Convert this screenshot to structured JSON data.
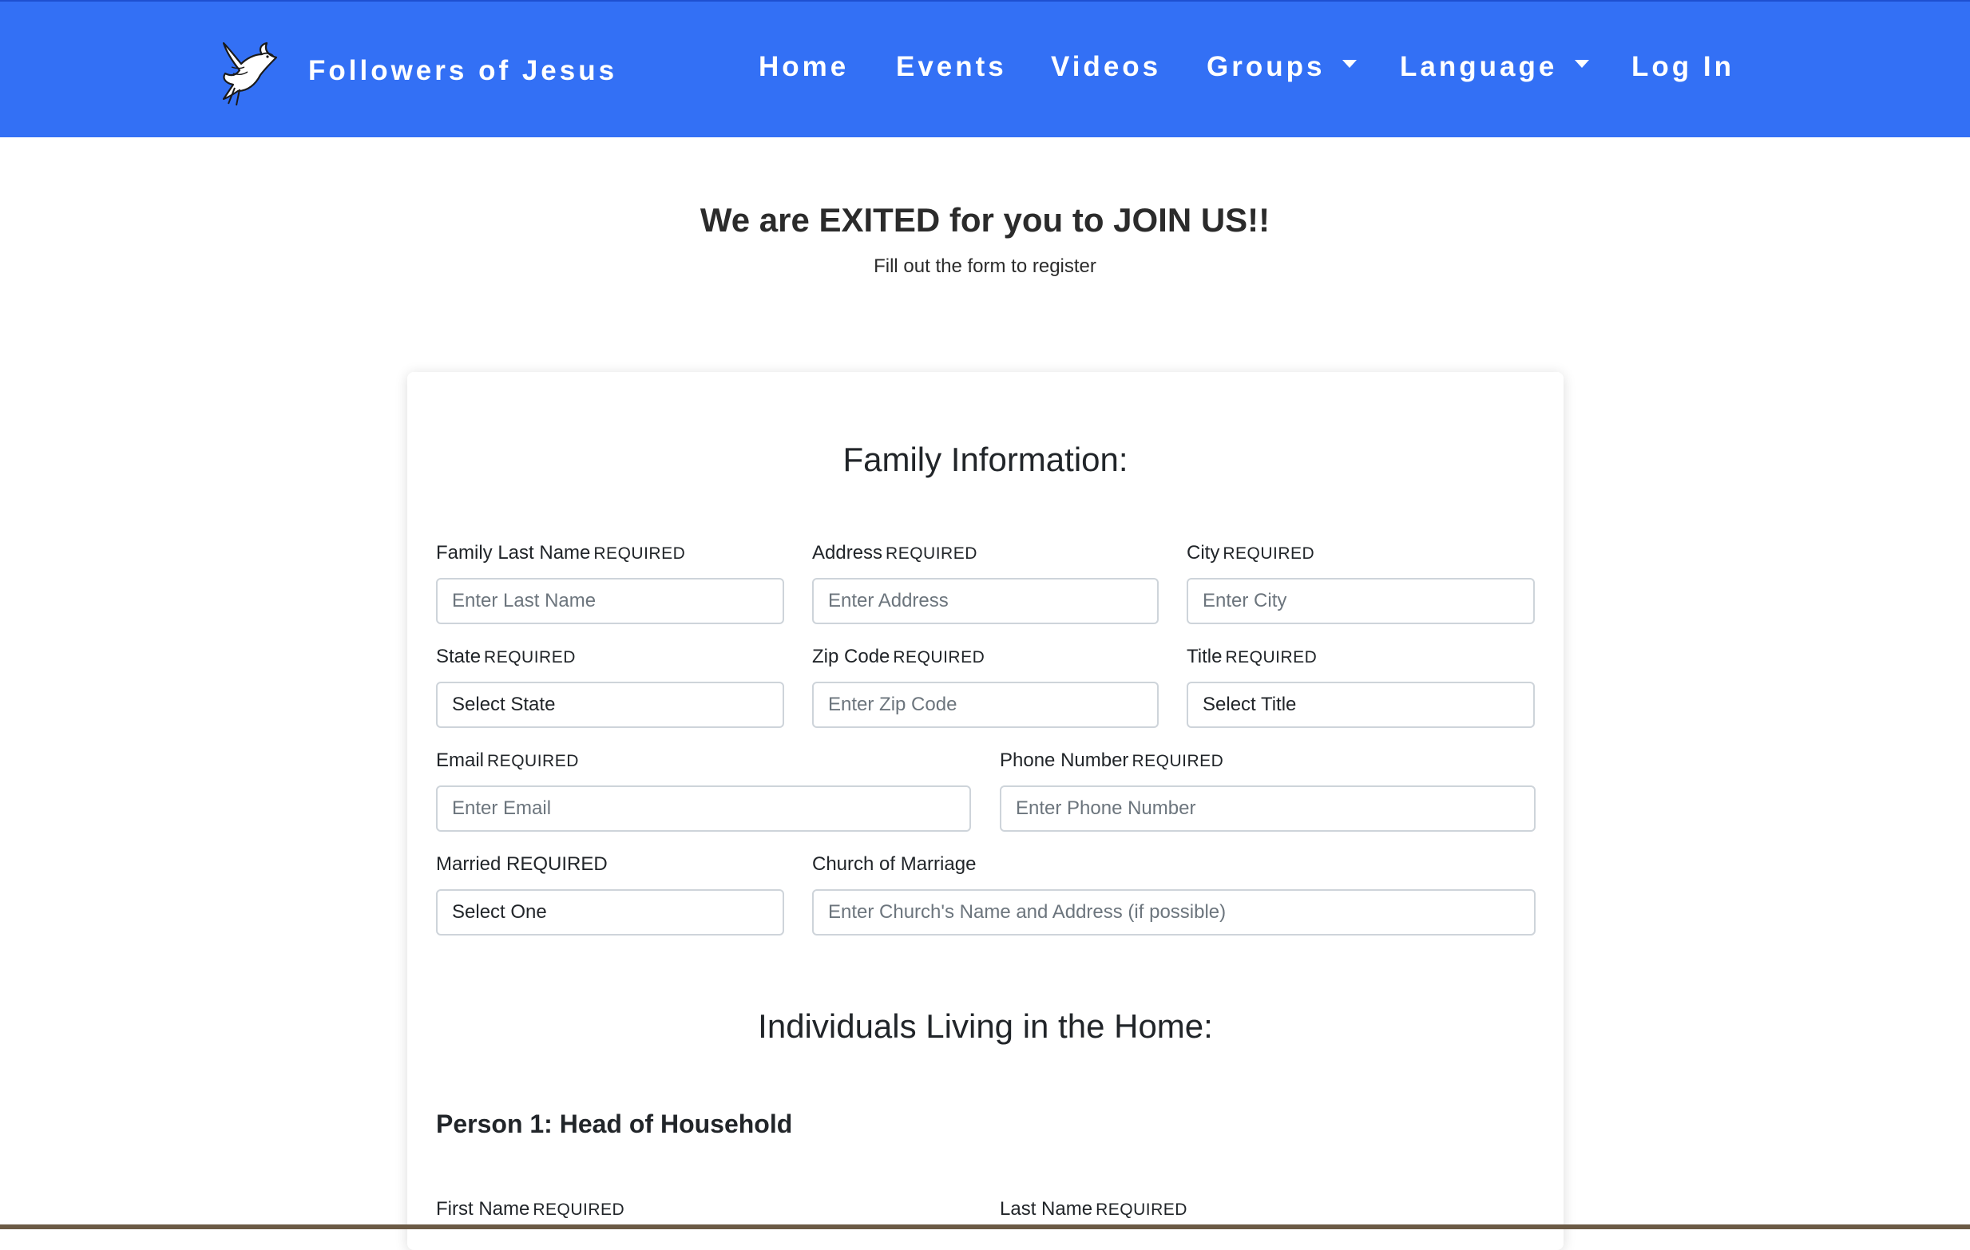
{
  "navbar": {
    "brand_name": "Followers of Jesus",
    "logo_icon": "dove-icon",
    "bg_color": "#3370f5",
    "items": [
      {
        "label": "Home"
      },
      {
        "label": "Events"
      },
      {
        "label": "Videos"
      },
      {
        "label": "Groups"
      },
      {
        "label": "Language"
      },
      {
        "label": "Log In"
      }
    ]
  },
  "hero": {
    "title": "We are EXITED for you to JOIN US!!",
    "subtitle": "Fill out the form to register"
  },
  "form": {
    "family_section_title": "Family Information:",
    "required_text": "REQUIRED",
    "fields": {
      "last_name": {
        "label": "Family Last Name",
        "placeholder": "Enter Last Name"
      },
      "address": {
        "label": "Address",
        "placeholder": "Enter Address"
      },
      "city": {
        "label": "City",
        "placeholder": "Enter City"
      },
      "state": {
        "label": "State",
        "value": "Select State"
      },
      "zip": {
        "label": "Zip Code",
        "placeholder": "Enter Zip Code"
      },
      "title": {
        "label": "Title",
        "value": "Select Title"
      },
      "email": {
        "label": "Email",
        "placeholder": "Enter Email"
      },
      "phone": {
        "label": "Phone Number",
        "placeholder": "Enter Phone Number"
      },
      "married": {
        "label": "Married REQUIRED",
        "value": "Select One"
      },
      "church": {
        "label": "Church of Marriage",
        "placeholder": "Enter Church's Name and Address (if possible)"
      }
    },
    "individuals_section_title": "Individuals Living in the Home:",
    "person1": {
      "title": "Person 1: Head of Household",
      "first_name_label": "First Name",
      "last_name_label": "Last Name"
    }
  }
}
